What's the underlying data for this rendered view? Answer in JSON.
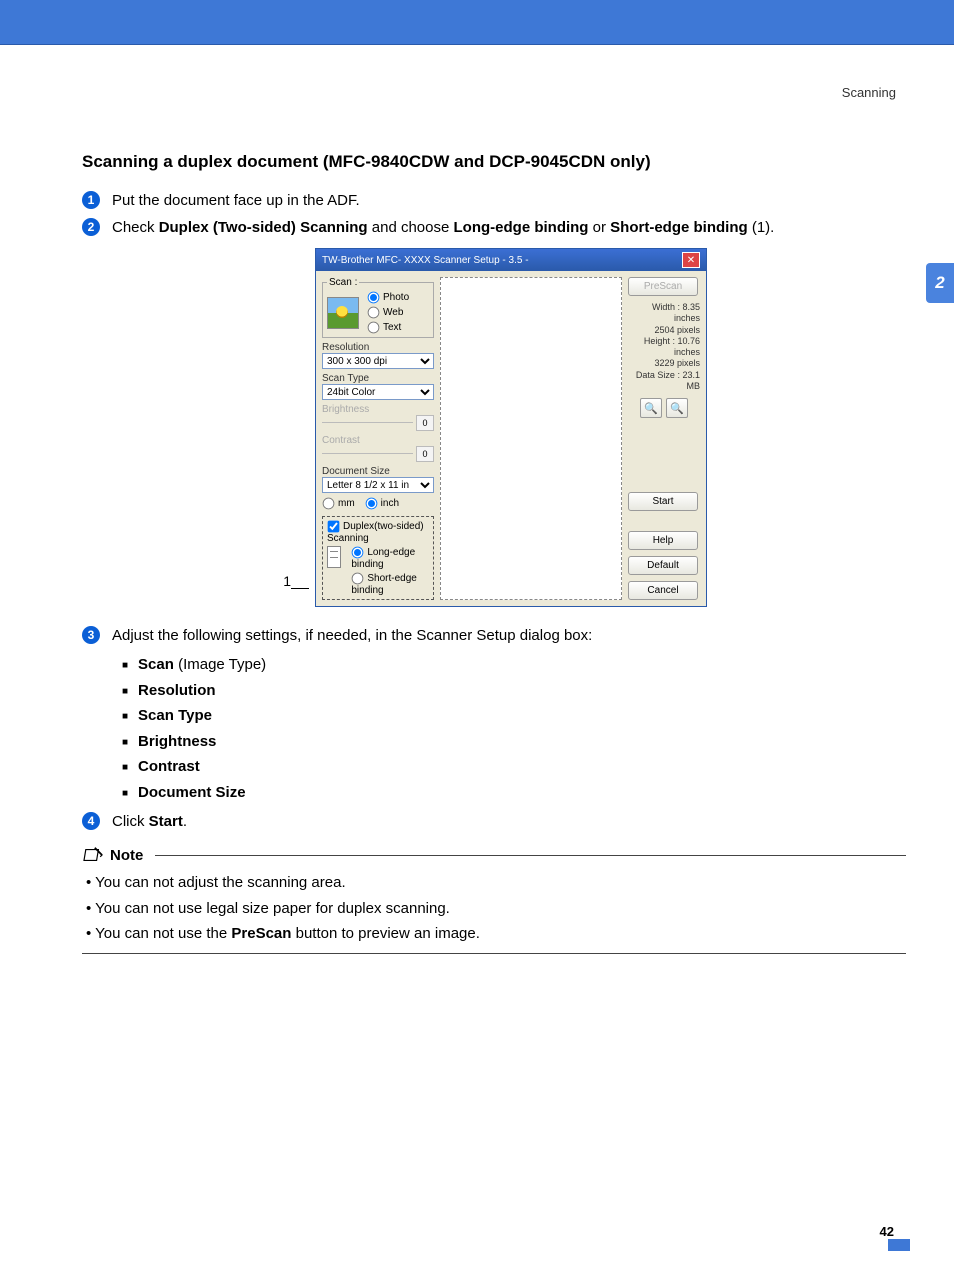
{
  "breadcrumb": "Scanning",
  "side_tab": "2",
  "title": "Scanning a duplex document (MFC-9840CDW and DCP-9045CDN only)",
  "steps": {
    "s1": {
      "num": "1",
      "text": "Put the document face up in the ADF."
    },
    "s2": {
      "num": "2",
      "pre": "Check ",
      "b1": "Duplex (Two-sided) Scanning",
      "mid": " and choose ",
      "b2": "Long-edge binding",
      "or": " or ",
      "b3": "Short-edge binding",
      "post": " (1)."
    },
    "s3": {
      "num": "3",
      "text": "Adjust the following settings, if needed, in the Scanner Setup dialog box:",
      "items": {
        "a_pre": "Scan",
        "a_post": " (Image Type)",
        "b": "Resolution",
        "c": "Scan Type",
        "d": "Brightness",
        "e": "Contrast",
        "f": "Document Size"
      }
    },
    "s4": {
      "num": "4",
      "pre": "Click ",
      "b": "Start",
      "post": "."
    }
  },
  "note": {
    "title": "Note",
    "n1": "You can not adjust the scanning area.",
    "n2": "You can not use legal size paper for duplex scanning.",
    "n3_pre": "You can not use the ",
    "n3_b": "PreScan",
    "n3_post": " button to preview an image."
  },
  "page_number": "42",
  "dialog": {
    "title": "TW-Brother MFC- XXXX  Scanner Setup - 3.5 -",
    "callout": "1",
    "scan_legend": "Scan :",
    "radio_photo": "Photo",
    "radio_web": "Web",
    "radio_text": "Text",
    "lbl_resolution": "Resolution",
    "dd_resolution": "300 x 300 dpi",
    "lbl_scantype": "Scan Type",
    "dd_scantype": "24bit Color",
    "lbl_brightness": "Brightness",
    "val_brightness": "0",
    "lbl_contrast": "Contrast",
    "val_contrast": "0",
    "lbl_docsize": "Document Size",
    "dd_docsize": "Letter 8 1/2 x 11 in",
    "unit_mm": "mm",
    "unit_inch": "inch",
    "chk_duplex": "Duplex(two-sided) Scanning",
    "radio_long": "Long-edge binding",
    "radio_short": "Short-edge binding",
    "btn_prescan": "PreScan",
    "info_w_lbl": "Width :",
    "info_w_val": "8.35 inches",
    "info_w_px": "2504 pixels",
    "info_h_lbl": "Height :",
    "info_h_val": "10.76 inches",
    "info_h_px": "3229 pixels",
    "info_ds_lbl": "Data Size :",
    "info_ds_val": "23.1 MB",
    "btn_start": "Start",
    "btn_help": "Help",
    "btn_default": "Default",
    "btn_cancel": "Cancel"
  }
}
